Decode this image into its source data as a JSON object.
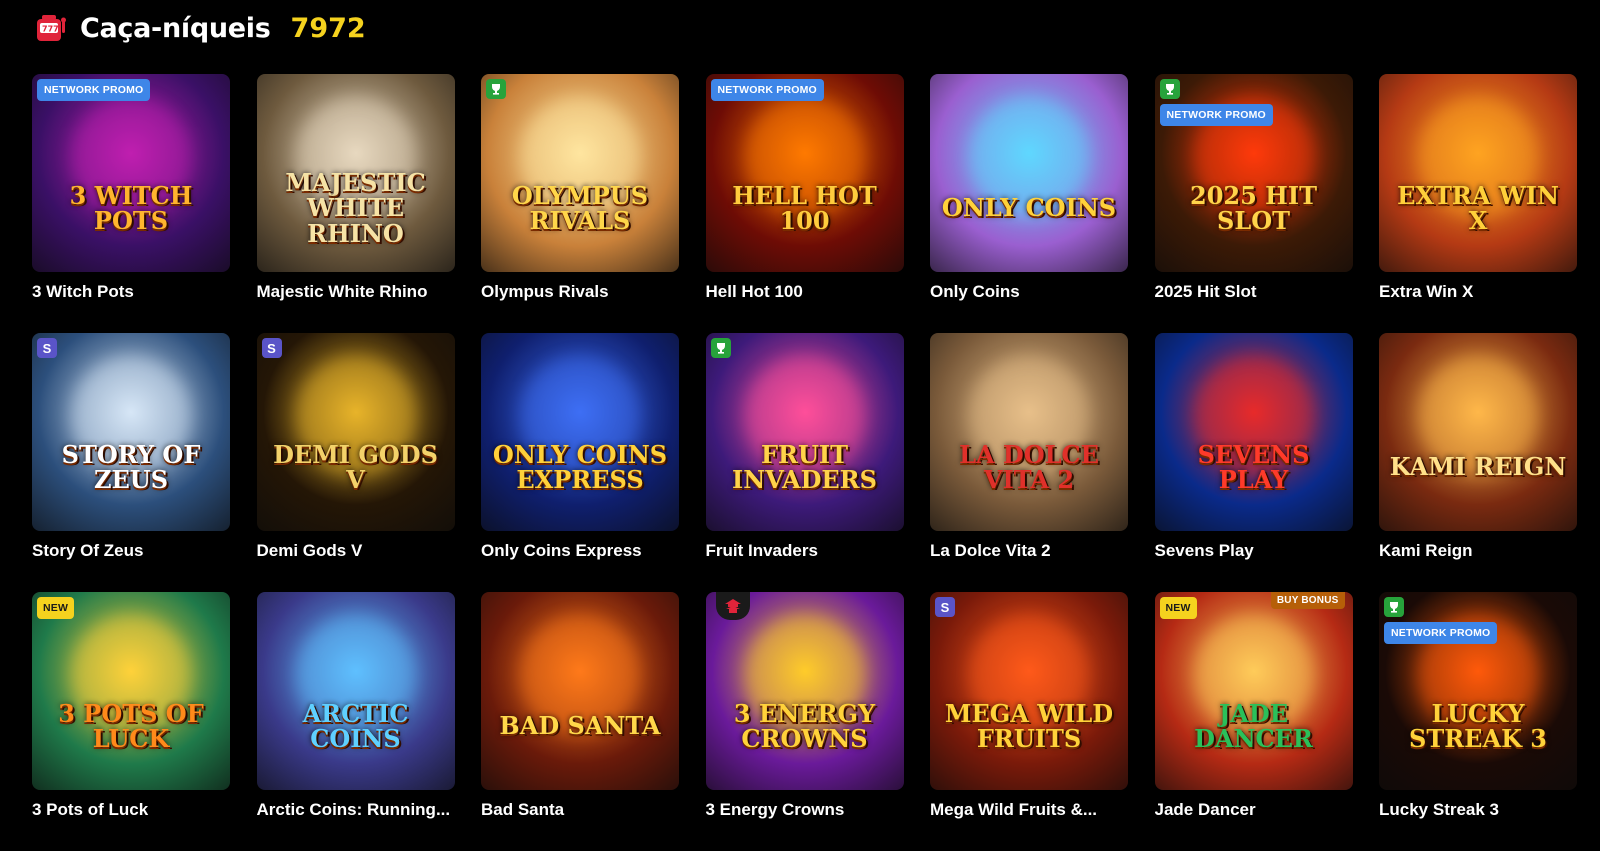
{
  "header": {
    "title": "Caça-níqueis",
    "count": "7972",
    "icon": "slot-machine-icon"
  },
  "games": [
    {
      "name": "3 Witch Pots",
      "logo": "3 Witch Pots",
      "badge": "Network Promo",
      "bg": "#3a1066",
      "accent": "#c01fb0",
      "logo_color": "#ffb52e"
    },
    {
      "name": "Majestic White Rhino",
      "logo": "Majestic White Rhino",
      "bg": "#6e5a3e",
      "accent": "#e8d9c0",
      "logo_color": "#f6e3a6"
    },
    {
      "name": "Olympus Rivals",
      "logo": "Olympus Rivals",
      "corner": "green",
      "bg": "#c9813a",
      "accent": "#ffe6a0",
      "logo_color": "#ffd64a"
    },
    {
      "name": "Hell Hot 100",
      "logo": "Hell Hot 100",
      "badge": "Network Promo",
      "bg": "#6e0c05",
      "accent": "#ff7a00",
      "logo_color": "#ffcc3d"
    },
    {
      "name": "Only Coins",
      "logo": "Only Coins",
      "bg": "#9a5fd0",
      "accent": "#5fd8ff",
      "logo_color": "#ffd23a"
    },
    {
      "name": "2025 Hit Slot",
      "logo": "2025 Hit Slot",
      "badge": "Network Promo",
      "corner": "green",
      "bg": "#3c1a06",
      "accent": "#ff3a0a",
      "logo_color": "#ffd34a"
    },
    {
      "name": "Extra Win X",
      "logo": "Extra Win X",
      "bg": "#b53a14",
      "accent": "#ffa421",
      "logo_color": "#ffd03a"
    },
    {
      "name": "Story Of Zeus",
      "logo": "Story Of Zeus",
      "corner": "purple",
      "bg": "#2c4f7c",
      "accent": "#d7e7f7",
      "logo_color": "#ffffff"
    },
    {
      "name": "Demi Gods V",
      "logo": "Demi Gods V",
      "corner": "purple",
      "bg": "#241606",
      "accent": "#e8b42a",
      "logo_color": "#f3d26a"
    },
    {
      "name": "Only Coins Express",
      "logo": "Only Coins Express",
      "bg": "#0f1f6e",
      "accent": "#3e6ff5",
      "logo_color": "#ffd13a"
    },
    {
      "name": "Fruit Invaders",
      "logo": "Fruit Invaders",
      "corner": "green",
      "bg": "#3d1a7a",
      "accent": "#ff4f9a",
      "logo_color": "#ffd34a"
    },
    {
      "name": "La Dolce Vita 2",
      "logo": "La Dolce Vita 2",
      "bg": "#7a5a3a",
      "accent": "#e8c08a",
      "logo_color": "#e0302a"
    },
    {
      "name": "Sevens Play",
      "logo": "Sevens Play",
      "bg": "#0a2a8a",
      "accent": "#e82a2a",
      "logo_color": "#ff3a2a"
    },
    {
      "name": "Kami Reign",
      "logo": "Kami Reign",
      "bg": "#7a2a10",
      "accent": "#ffb84a",
      "logo_color": "#ffe08a"
    },
    {
      "name": "3 Pots of Luck",
      "logo": "3 Pots of Luck",
      "badge_new": "New",
      "bg": "#1f7a4a",
      "accent": "#ffd23a",
      "logo_color": "#ff8a1a"
    },
    {
      "name": "Arctic Coins: Running...",
      "logo": "Arctic Coins",
      "bg": "#3a3a8a",
      "accent": "#5fc0ff",
      "logo_color": "#5fd0ff"
    },
    {
      "name": "Bad Santa",
      "logo": "Bad Santa",
      "bg": "#6a1a0a",
      "accent": "#ff7a1a",
      "logo_color": "#ffd84a"
    },
    {
      "name": "3 Energy Crowns",
      "logo": "3 Energy Crowns",
      "corner": "dark",
      "bg": "#6a1a9a",
      "accent": "#ffcc2a",
      "logo_color": "#ffd23a"
    },
    {
      "name": "Mega Wild Fruits &...",
      "logo": "Mega Wild Fruits",
      "corner": "purple",
      "bg": "#7a1a0a",
      "accent": "#ff5a1a",
      "logo_color": "#ffd23a"
    },
    {
      "name": "Jade Dancer",
      "logo": "Jade Dancer",
      "badge_new": "New",
      "badge_buy": "Buy Bonus",
      "bg": "#b52a14",
      "accent": "#ffcc5a",
      "logo_color": "#2ac05a"
    },
    {
      "name": "Lucky Streak 3",
      "logo": "Lucky Streak 3",
      "badge": "Network Promo",
      "corner": "green",
      "bg": "#1a0a06",
      "accent": "#ff5a0a",
      "logo_color": "#ffd23a"
    }
  ]
}
